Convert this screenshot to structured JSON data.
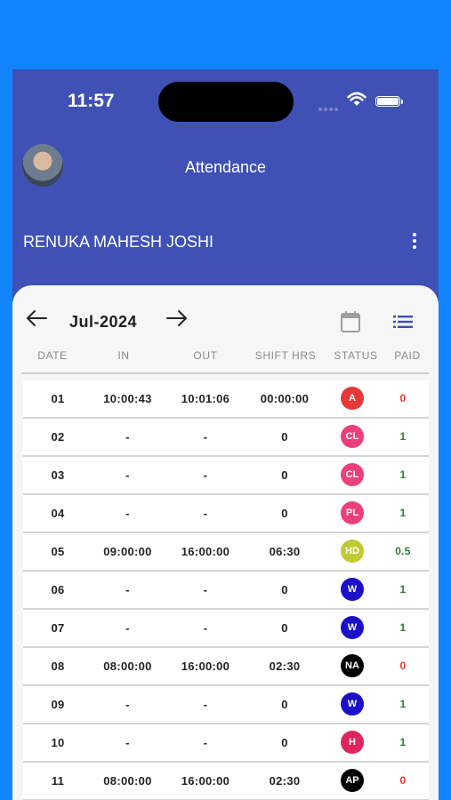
{
  "status_bar": {
    "time": "11:57"
  },
  "header": {
    "title": "Attendance",
    "employee_name": "RENUKA MAHESH JOSHI"
  },
  "month_nav": {
    "month": "Jul-2024"
  },
  "table": {
    "columns": [
      "DATE",
      "IN",
      "OUT",
      "SHIFT HRS",
      "STATUS",
      "PAID"
    ],
    "rows": [
      {
        "date": "01",
        "in": "10:00:43",
        "out": "10:01:06",
        "shift": "00:00:00",
        "status": "A",
        "paid": "0"
      },
      {
        "date": "02",
        "in": "-",
        "out": "-",
        "shift": "0",
        "status": "CL",
        "paid": "1"
      },
      {
        "date": "03",
        "in": "-",
        "out": "-",
        "shift": "0",
        "status": "CL",
        "paid": "1"
      },
      {
        "date": "04",
        "in": "-",
        "out": "-",
        "shift": "0",
        "status": "PL",
        "paid": "1"
      },
      {
        "date": "05",
        "in": "09:00:00",
        "out": "16:00:00",
        "shift": "06:30",
        "status": "HD",
        "paid": "0.5"
      },
      {
        "date": "06",
        "in": "-",
        "out": "-",
        "shift": "0",
        "status": "W",
        "paid": "1"
      },
      {
        "date": "07",
        "in": "-",
        "out": "-",
        "shift": "0",
        "status": "W",
        "paid": "1"
      },
      {
        "date": "08",
        "in": "08:00:00",
        "out": "16:00:00",
        "shift": "02:30",
        "status": "NA",
        "paid": "0"
      },
      {
        "date": "09",
        "in": "-",
        "out": "-",
        "shift": "0",
        "status": "W",
        "paid": "1"
      },
      {
        "date": "10",
        "in": "-",
        "out": "-",
        "shift": "0",
        "status": "H",
        "paid": "1"
      },
      {
        "date": "11",
        "in": "08:00:00",
        "out": "16:00:00",
        "shift": "02:30",
        "status": "AP",
        "paid": "0"
      }
    ]
  },
  "colors": {
    "header_bg": "#3f51b5",
    "page_bg": "#1184fb",
    "status": {
      "A": "#e53935",
      "CL": "#ec407a",
      "PL": "#ec407a",
      "HD": "#c0ca33",
      "W": "#1a10c9",
      "NA": "#000000",
      "H": "#e0245e",
      "AP": "#000000"
    },
    "paid_positive": "#2e7d32",
    "paid_zero": "#e53935"
  },
  "icons": {
    "back": "arrow-left-icon",
    "forward": "arrow-right-icon",
    "calendar": "calendar-icon",
    "list": "list-icon",
    "more": "more-vertical-icon"
  }
}
